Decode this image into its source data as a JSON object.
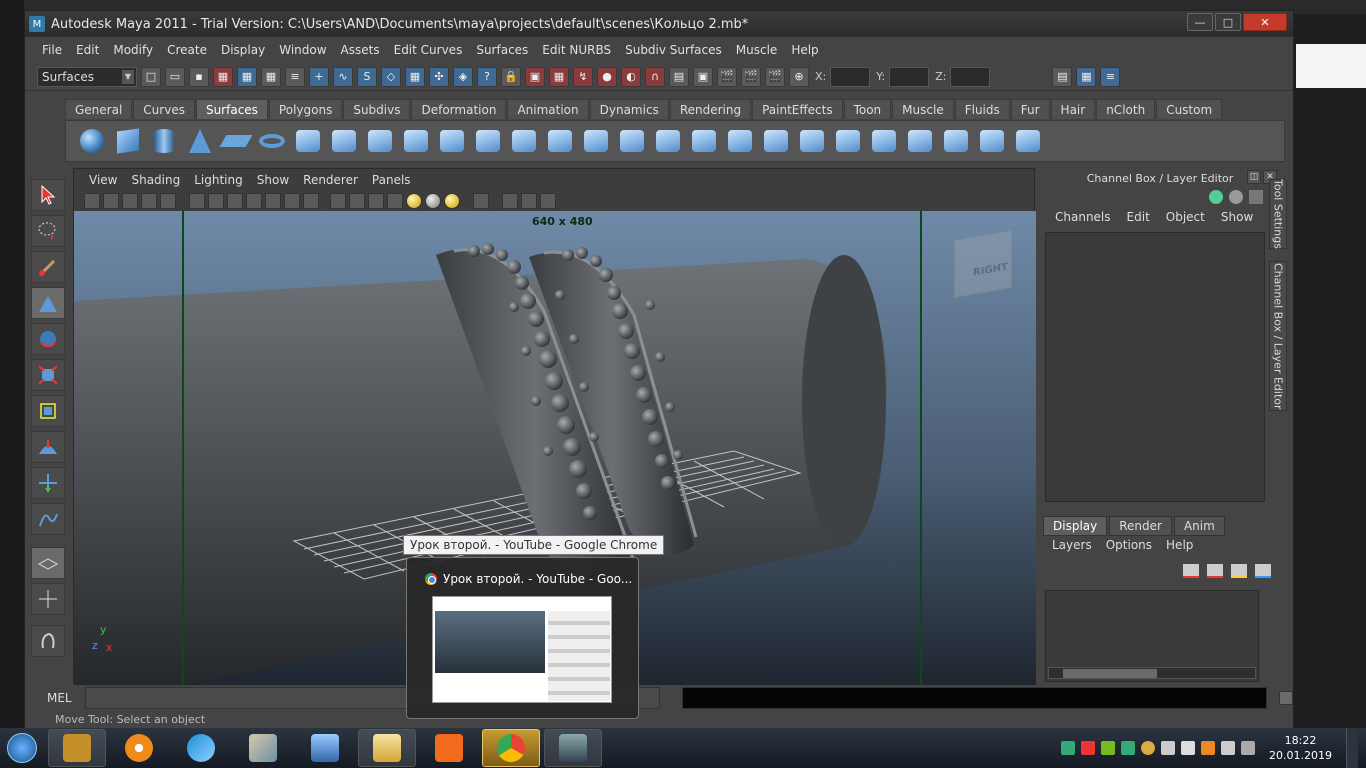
{
  "window": {
    "title": "Autodesk Maya 2011 - Trial Version: C:\\Users\\AND\\Documents\\maya\\projects\\default\\scenes\\Кольцо 2.mb*",
    "minimize": "—",
    "maximize": "□",
    "close": "✕"
  },
  "menubar": [
    "File",
    "Edit",
    "Modify",
    "Create",
    "Display",
    "Window",
    "Assets",
    "Edit Curves",
    "Surfaces",
    "Edit NURBS",
    "Subdiv Surfaces",
    "Muscle",
    "Help"
  ],
  "statusline": {
    "mode": "Surfaces",
    "coord_labels": [
      "X:",
      "Y:",
      "Z:"
    ]
  },
  "shelf": {
    "tabs": [
      "General",
      "Curves",
      "Surfaces",
      "Polygons",
      "Subdivs",
      "Deformation",
      "Animation",
      "Dynamics",
      "Rendering",
      "PaintEffects",
      "Toon",
      "Muscle",
      "Fluids",
      "Fur",
      "Hair",
      "nCloth",
      "Custom"
    ],
    "active_tab": "Surfaces"
  },
  "viewport": {
    "menu": [
      "View",
      "Shading",
      "Lighting",
      "Show",
      "Renderer",
      "Panels"
    ],
    "resolution": "640 x 480",
    "viewcube_label": "RIGHT",
    "axis": {
      "x": "x",
      "y": "y",
      "z": "z"
    }
  },
  "channel_box": {
    "title": "Channel Box / Layer Editor",
    "menu": [
      "Channels",
      "Edit",
      "Object",
      "Show"
    ],
    "side_tabs": [
      "Tool Settings",
      "Channel Box / Layer Editor"
    ]
  },
  "layer_editor": {
    "tabs": [
      "Display",
      "Render",
      "Anim"
    ],
    "active_tab": "Display",
    "menu": [
      "Layers",
      "Options",
      "Help"
    ]
  },
  "command_line": {
    "label": "MEL",
    "help_text": "Move Tool: Select an object"
  },
  "tooltip": {
    "text": "Урок второй. - YouTube - Google Chrome"
  },
  "preview": {
    "title": "Урок второй. - YouTube - Goo..."
  },
  "taskbar": {
    "time": "18:22",
    "date": "20.01.2019"
  }
}
